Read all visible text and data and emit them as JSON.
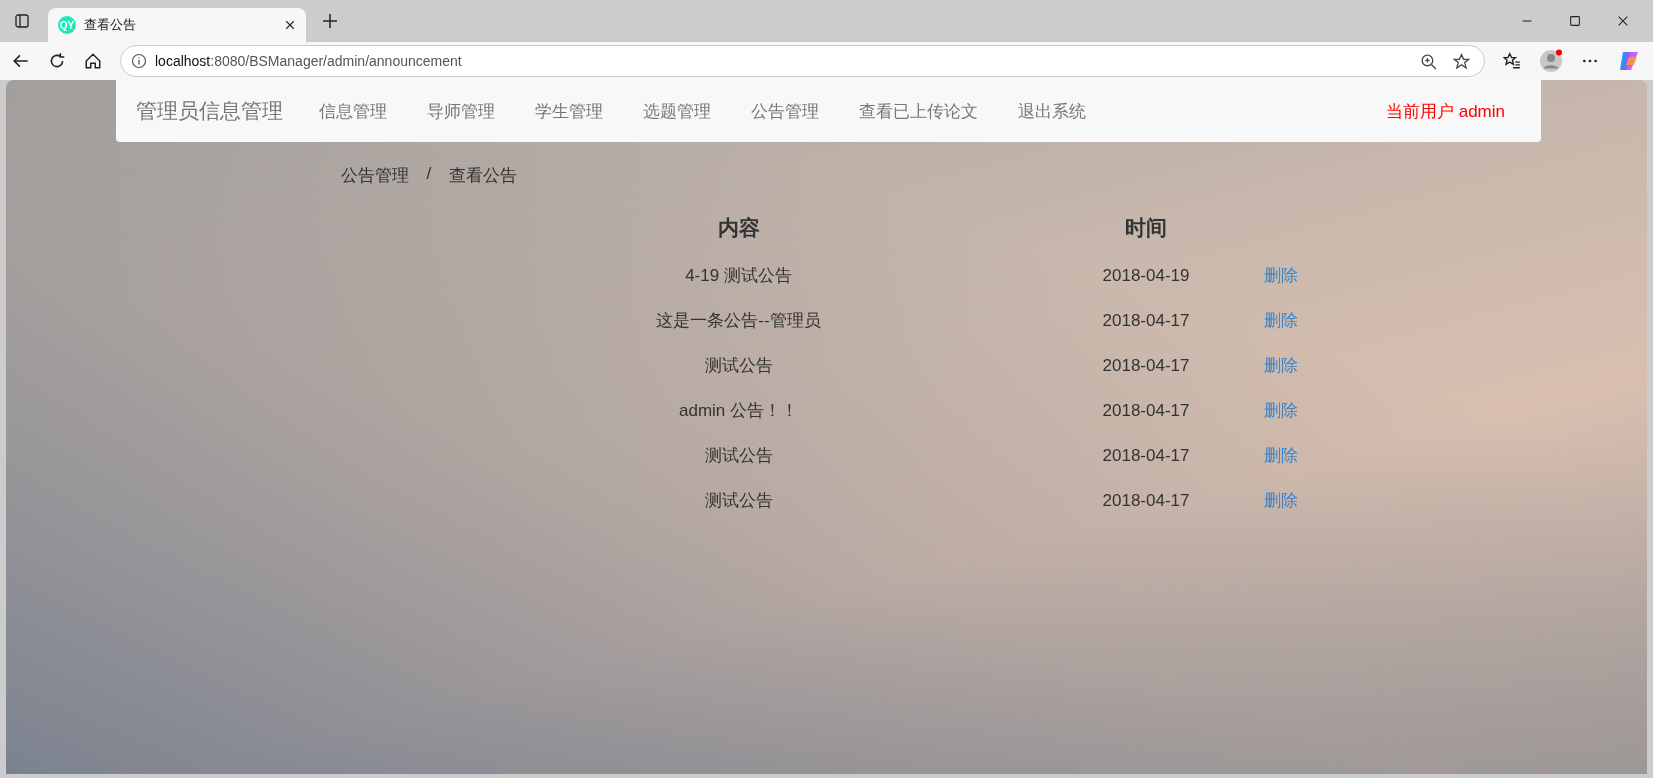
{
  "browser": {
    "tab_title": "查看公告",
    "tab_icon_text": "QY",
    "url_host": "localhost",
    "url_path": ":8080/BSManager/admin/announcement"
  },
  "navbar": {
    "brand": "管理员信息管理",
    "items": [
      {
        "label": "信息管理"
      },
      {
        "label": "导师管理"
      },
      {
        "label": "学生管理"
      },
      {
        "label": "选题管理"
      },
      {
        "label": "公告管理"
      },
      {
        "label": "查看已上传论文"
      },
      {
        "label": "退出系统"
      }
    ],
    "current_user": "当前用户 admin"
  },
  "breadcrumb": [
    "公告管理",
    "查看公告"
  ],
  "breadcrumb_separator": "/",
  "table": {
    "columns": [
      "内容",
      "时间"
    ],
    "rows": [
      {
        "content": "4-19 测试公告",
        "time": "2018-04-19",
        "action": "删除"
      },
      {
        "content": "这是一条公告--管理员",
        "time": "2018-04-17",
        "action": "删除"
      },
      {
        "content": "测试公告",
        "time": "2018-04-17",
        "action": "删除"
      },
      {
        "content": "admin 公告！！",
        "time": "2018-04-17",
        "action": "删除"
      },
      {
        "content": "测试公告",
        "time": "2018-04-17",
        "action": "删除"
      },
      {
        "content": "测试公告",
        "time": "2018-04-17",
        "action": "删除"
      }
    ]
  }
}
